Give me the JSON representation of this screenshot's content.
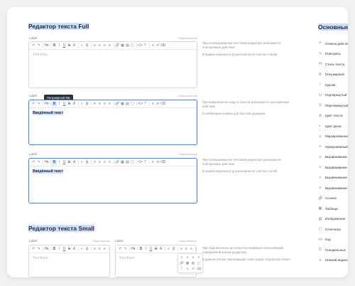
{
  "section_full": {
    "title": "Редактор текста Full"
  },
  "section_small": {
    "title": "Редактор текста Small"
  },
  "label": "Label",
  "optional": "Опциональное",
  "optional_short": "Опционально",
  "placeholder": "Text Area",
  "typed_text": "Введённый текст",
  "tooltip": "Полужирный ЖБ",
  "desc1": {
    "p1": "При полноразмерном текстовом редакторе указываются повторяемые действия",
    "p2": "В правом верхнем углу располагается очистка стилей"
  },
  "desc2": {
    "p1": "При измерении на ходку в пунктов указываются пользованные действия",
    "p2": "и комбинации клавиш для быстрой редакции"
  },
  "desc3": {
    "p1": "При полноразмерном текстовом редакторе указываются повторяемые действия",
    "p2": "В правом верхнем углу располагается очистка стилей"
  },
  "desc4": {
    "p1": "При ограниченном пространстве возможно использование сокращённой версии редактора",
    "p2": "В данном случае невлезающие стили уходят под кнопку «Ещё»"
  },
  "toolbar": [
    "↶",
    "↷",
    "H▾",
    "B",
    "I",
    "U",
    "S",
    "A",
    "◐",
    "A̲",
    "≡",
    "≡",
    "≡",
    "≡",
    "🔗",
    "▦",
    "▤",
    "▢",
    "</>",
    "⊤",
    "x",
    "x²",
    "⌫"
  ],
  "sidebar": {
    "title": "Основные действия",
    "items": [
      {
        "icon": "↶",
        "label": "Отмена действия"
      },
      {
        "icon": "↷",
        "label": "Повторить"
      },
      {
        "icon": "H",
        "label": "Стиль текста"
      },
      {
        "icon": "B",
        "label": "Полужирный"
      },
      {
        "icon": "I",
        "label": "Курсив"
      },
      {
        "icon": "U",
        "label": "Подчёркнутый"
      },
      {
        "icon": "S",
        "label": "Перечёркнутый"
      },
      {
        "icon": "A",
        "label": "Цвет текста"
      },
      {
        "icon": "◐",
        "label": "Цвет фона"
      },
      {
        "icon": "≡",
        "label": "Маркированный"
      },
      {
        "icon": "≡",
        "label": "Нумерованный"
      },
      {
        "icon": "≡",
        "label": "Выравнивание"
      },
      {
        "icon": "≡",
        "label": "Выравнивание"
      },
      {
        "icon": "≡",
        "label": "Выравнивание"
      },
      {
        "icon": "≡",
        "label": "Выравнивание"
      },
      {
        "icon": "🔗",
        "label": "Ссылка"
      },
      {
        "icon": "▦",
        "label": "Таблица"
      },
      {
        "icon": "▤",
        "label": "Изображение"
      },
      {
        "icon": "▢",
        "label": "Отпечатка"
      },
      {
        "icon": "</>",
        "label": "Код"
      },
      {
        "icon": "Ω",
        "label": "Специальные"
      },
      {
        "icon": "x",
        "label": "Нижний индекс"
      }
    ]
  },
  "colors": {
    "accent": "#3b82f6",
    "highlight": "#cfe0f8",
    "title": "#1e2a44"
  }
}
